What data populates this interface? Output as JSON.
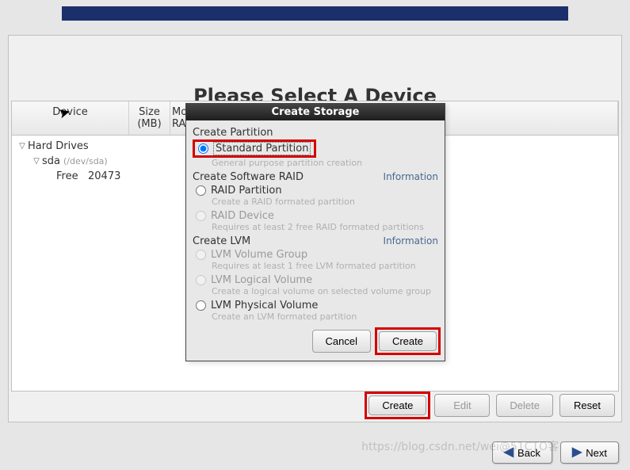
{
  "heading": "Please Select A Device",
  "table": {
    "headers": {
      "device": "Device",
      "size": "Size\n(MB)",
      "rest": "Mo\nRAI"
    },
    "rows": {
      "hard_drives": "Hard Drives",
      "sda": "sda",
      "sda_path": "(/dev/sda)",
      "free": "Free",
      "free_size": "20473"
    }
  },
  "buttons": {
    "create": "Create",
    "edit": "Edit",
    "delete": "Delete",
    "reset": "Reset"
  },
  "dialog": {
    "title": "Create Storage",
    "sections": {
      "create_partition": "Create Partition",
      "create_raid": "Create Software RAID",
      "create_lvm": "Create LVM",
      "info": "Information"
    },
    "options": {
      "standard_partition": "Standard Partition",
      "standard_partition_desc": "General purpose partition creation",
      "raid_partition": "RAID Partition",
      "raid_partition_desc": "Create a RAID formated partition",
      "raid_device": "RAID Device",
      "raid_device_desc": "Requires at least 2 free RAID formated partitions",
      "lvm_vg": "LVM Volume Group",
      "lvm_vg_desc": "Requires at least 1 free LVM formated partition",
      "lvm_lv": "LVM Logical Volume",
      "lvm_lv_desc": "Create a logical volume on selected volume group",
      "lvm_pv": "LVM Physical Volume",
      "lvm_pv_desc": "Create an LVM formated partition"
    },
    "buttons": {
      "cancel": "Cancel",
      "create": "Create"
    }
  },
  "nav": {
    "back": "Back",
    "next": "Next"
  },
  "watermark": "https://blog.csdn.net/wei@51CTO客"
}
